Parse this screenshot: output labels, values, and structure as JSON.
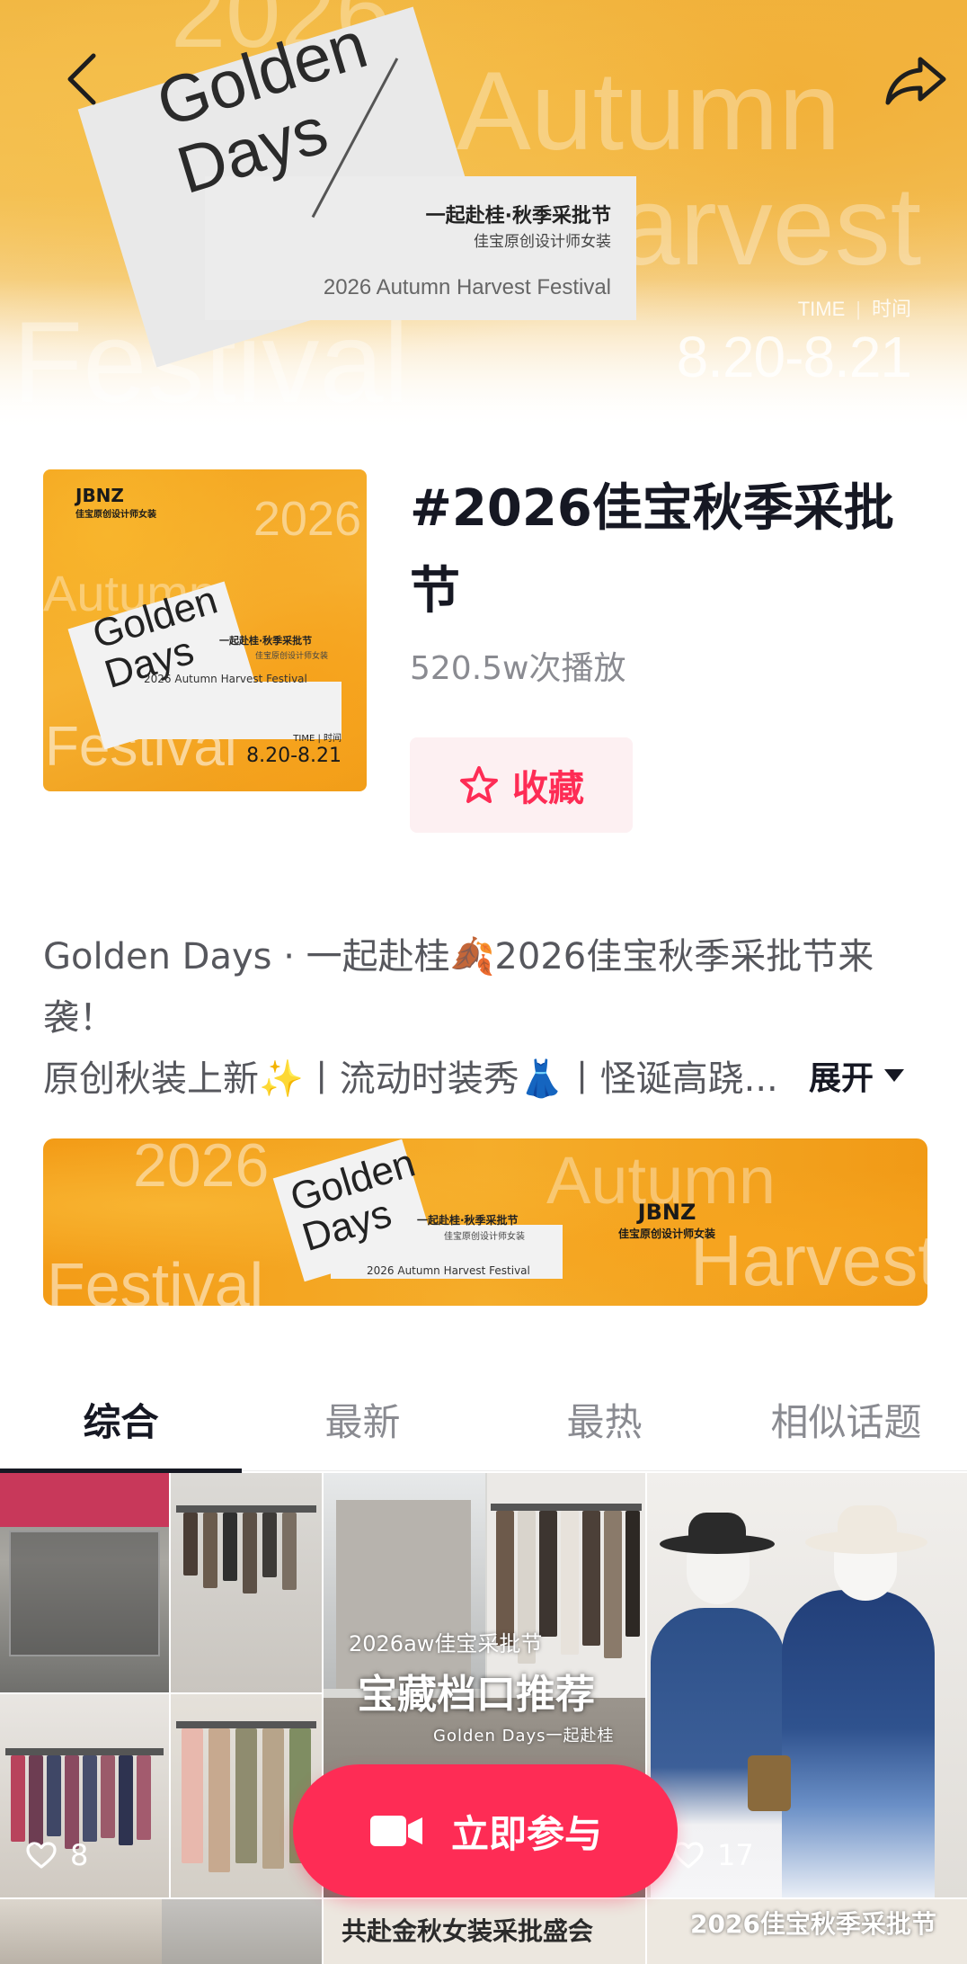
{
  "hero": {
    "card_title": "Golden Days",
    "card_line1": "一起赴桂·秋季采批节",
    "card_line2": "佳宝原创设计师女装",
    "card_en": "2026 Autumn Harvest Festival",
    "bg_year": "2026",
    "bg_autumn": "Autumn",
    "bg_harvest": "Harvest",
    "bg_festival": "Festival",
    "time_label_en": "TIME",
    "time_label_cn": "时间",
    "date": "8.20-8.21",
    "icons": {
      "back": "back-arrow-icon",
      "share": "share-icon"
    }
  },
  "topic": {
    "cover": {
      "brand": "JBNZ",
      "brand_sub": "佳宝原创设计师女装",
      "year": "2026",
      "autumn": "Autumn",
      "festival": "Festival",
      "title": "Golden Days",
      "line1": "一起赴桂·秋季采批节",
      "line2": "佳宝原创设计师女装",
      "en": "2026 Autumn Harvest Festival",
      "time": "TIME  |  时间",
      "date": "8.20-8.21"
    },
    "title": "#2026佳宝秋季采批节",
    "plays": "520.5w次播放",
    "favorite_label": "收藏",
    "favorite_icon": "star-outline-icon"
  },
  "description": {
    "line1": "Golden  Days · 一起赴桂🍂2026佳宝秋季采批节来袭！",
    "line2": "原创秋装上新✨丨流动时装秀👗丨怪诞高跷...",
    "expand_label": "展开"
  },
  "wide_banner": {
    "year": "2026",
    "autumn": "Autumn",
    "harvest": "Harvest",
    "festival": "Festival",
    "title": "Golden Days",
    "line1": "一起赴桂·秋季采批节",
    "line2": "佳宝原创设计师女装",
    "en": "2026 Autumn Harvest Festival",
    "brand": "JBNZ",
    "brand_sub": "佳宝原创设计师女装"
  },
  "tabs": [
    {
      "label": "综合",
      "active": true
    },
    {
      "label": "最新",
      "active": false
    },
    {
      "label": "最热",
      "active": false
    },
    {
      "label": "相似话题",
      "active": false
    }
  ],
  "videos": [
    {
      "likes": "8"
    },
    {
      "overlay1": "2026aw佳宝采批节",
      "overlay2": "宝藏档口推荐",
      "overlay3": "Golden Days一起赴桂"
    },
    {
      "likes": "17"
    },
    {},
    {
      "title": "共赴金秋女装采批盛会"
    },
    {
      "title": "2026佳宝秋季采批节"
    }
  ],
  "cta": {
    "label": "立即参与",
    "icon": "video-camera-icon"
  },
  "colors": {
    "accent": "#fe2c55",
    "accent_bg": "#fdf0f2",
    "text_primary": "#161823",
    "text_secondary": "#8a8b91"
  }
}
